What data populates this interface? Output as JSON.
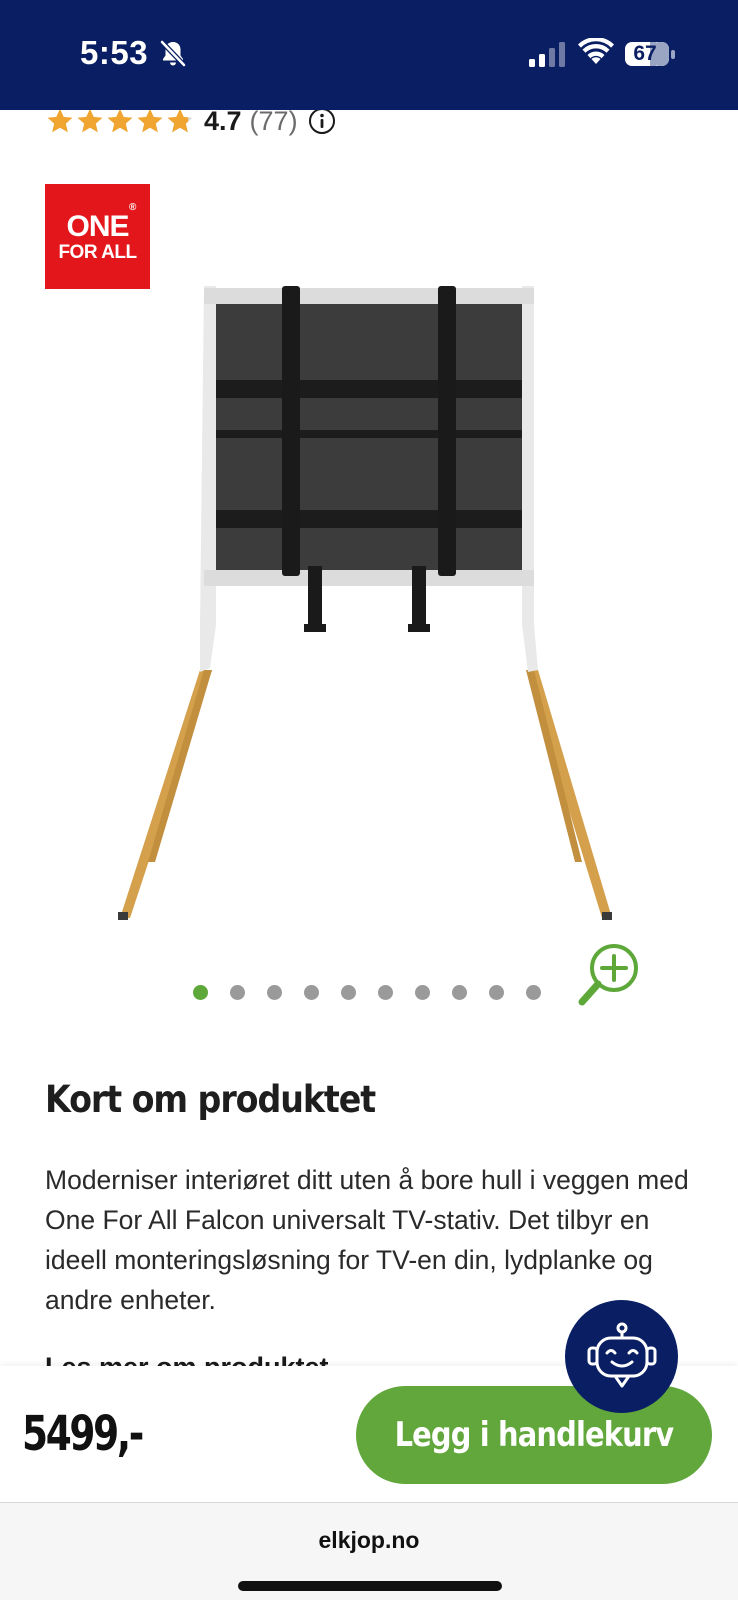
{
  "status_bar": {
    "time": "5:53",
    "battery": "67",
    "icons": [
      "bell-slash-icon",
      "signal-icon",
      "wifi-icon",
      "battery-icon"
    ]
  },
  "rating": {
    "value": "4.7",
    "count": "(77)",
    "stars": 4.7
  },
  "brand": {
    "line1": "ONE",
    "line2": "FOR ALL",
    "registered": "®",
    "color": "#e3161b"
  },
  "carousel": {
    "total": 10,
    "active_index": 0
  },
  "description": {
    "title": "Kort om produktet",
    "text": "Moderniser interiøret ditt uten å bore hull i veggen med One For All Falcon universalt TV-stativ. Det tilbyr en ideell monteringsløsning for TV-en din, lydplanke og andre enheter.",
    "read_more": "Les mer om produktet"
  },
  "purchase": {
    "price": "5499,-",
    "button_label": "Legg i handlekurv"
  },
  "browser": {
    "url": "elkjop.no"
  },
  "colors": {
    "header": "#0a1f63",
    "accent_green": "#62a73b",
    "star": "#f0a531"
  }
}
